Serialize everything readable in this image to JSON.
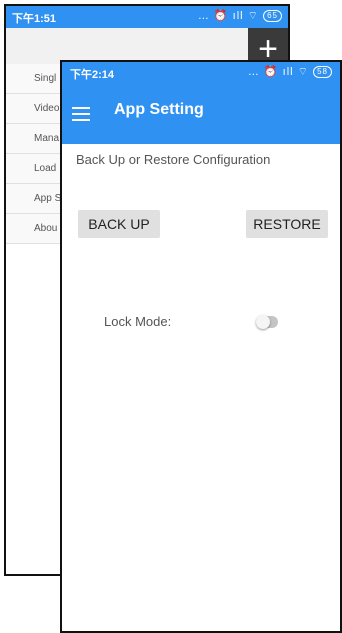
{
  "back": {
    "status_time": "下午1:51",
    "status_icons": "… ⏰ ıll ⌔",
    "battery": "65",
    "items": [
      {
        "label": "Singl"
      },
      {
        "label": "Video"
      },
      {
        "label": "Mana"
      },
      {
        "label": "Load"
      },
      {
        "label": "App S"
      },
      {
        "label": "Abou"
      }
    ]
  },
  "front": {
    "status_time": "下午2:14",
    "status_icons": "… ⏰ ıll ⌔",
    "battery": "58",
    "title": "App Setting",
    "section_label": "Back Up or Restore Configuration",
    "backup_label": "BACK UP",
    "restore_label": "RESTORE",
    "lock_label": "Lock Mode:",
    "lock_enabled": false
  }
}
